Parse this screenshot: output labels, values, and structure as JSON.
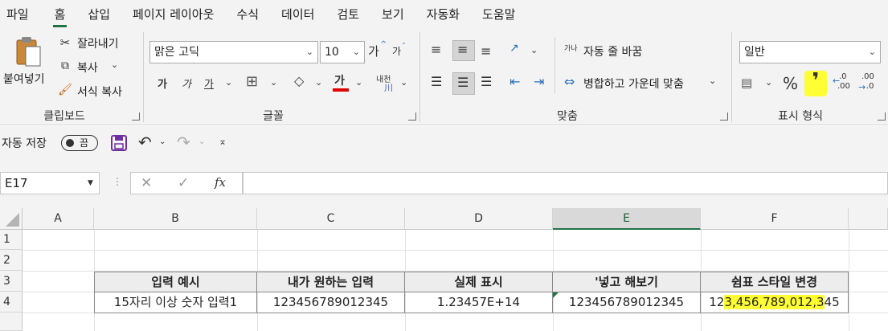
{
  "menu": {
    "tabs": [
      "파일",
      "홈",
      "삽입",
      "페이지 레이아웃",
      "수식",
      "데이터",
      "검토",
      "보기",
      "자동화",
      "도움말"
    ],
    "active_tab": "홈"
  },
  "ribbon": {
    "clipboard": {
      "paste_label": "붙여넣기",
      "cut_label": "잘라내기",
      "copy_label": "복사",
      "format_painter_label": "서식 복사",
      "group_label": "클립보드"
    },
    "font": {
      "font_name": "맑은 고딕",
      "font_size": "10",
      "grow_label": "가",
      "shrink_label": "가",
      "bold_label": "가",
      "italic_label": "가",
      "underline_label": "가",
      "font_color_label": "가",
      "phonetic_top": "내천",
      "group_label": "글꼴",
      "font_color": "#e00000"
    },
    "alignment": {
      "wrap_text_label": "자동 줄 바꿈",
      "merge_center_label": "병합하고 가운데 맞춤",
      "group_label": "맞춤",
      "wrap_icon_text": "가나"
    },
    "number": {
      "format_value": "일반",
      "percent_label": "%",
      "comma_label": "❜",
      "inc_decimal_top": ".0",
      "inc_decimal_bottom": ".00",
      "dec_decimal_top": ".00",
      "dec_decimal_bottom": ".0",
      "group_label": "표시 형식",
      "highlight_color": "#ffff33"
    }
  },
  "qat": {
    "autosave_label": "자동 저장",
    "toggle_text": "끔"
  },
  "formula_bar": {
    "name_box": "E17",
    "fx_label": "fx",
    "formula": ""
  },
  "sheet": {
    "columns": [
      "A",
      "B",
      "C",
      "D",
      "E",
      "F"
    ],
    "selected_column": "E",
    "rows": [
      "1",
      "2",
      "3",
      "4"
    ],
    "table_headers": [
      "입력 예시",
      "내가 원하는 입력",
      "실제 표시",
      "'넣고 해보기",
      "쉼표 스타일 변경"
    ],
    "table_row": [
      "15자리 이상 숫자 입력1",
      "123456789012345",
      "1.23457E+14",
      "123456789012345"
    ],
    "last_cell_prefix": "12",
    "last_cell_highlight": "3,456,789,012,3",
    "last_cell_suffix": "45",
    "accent": "#217346"
  }
}
